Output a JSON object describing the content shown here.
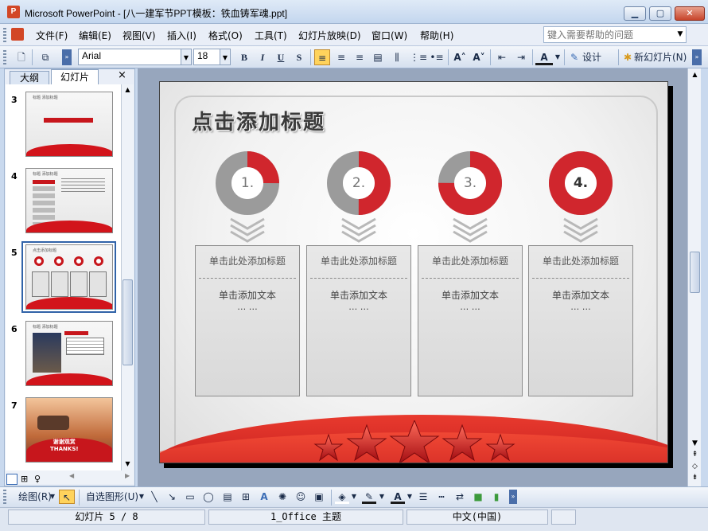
{
  "window": {
    "title": "Microsoft PowerPoint - [八一建军节PPT模板：铁血铸军魂.ppt]",
    "app_icon": "P"
  },
  "menu": {
    "items": [
      "文件(F)",
      "编辑(E)",
      "视图(V)",
      "插入(I)",
      "格式(O)",
      "工具(T)",
      "幻灯片放映(D)",
      "窗口(W)",
      "帮助(H)"
    ],
    "help_placeholder": "键入需要帮助的问题"
  },
  "toolbar": {
    "font": "Arial",
    "size": "18",
    "bold": "B",
    "italic": "I",
    "underline": "U",
    "shadow": "S",
    "design": "设计(S)",
    "new_slide": "新幻灯片(N)"
  },
  "left_pane": {
    "tabs": [
      "大纲",
      "幻灯片"
    ],
    "close": "×",
    "slide_numbers": [
      "3",
      "4",
      "5",
      "6",
      "7"
    ],
    "thumb7_text": "谢谢观赏\nTHANKS!"
  },
  "slide": {
    "title": "点击添加标题",
    "steps": [
      {
        "label": "1.",
        "fill": 0.25,
        "heading": "单击此处添加标题",
        "text": "单击添加文本",
        "dots": "… …"
      },
      {
        "label": "2.",
        "fill": 0.5,
        "heading": "单击此处添加标题",
        "text": "单击添加文本",
        "dots": "… …"
      },
      {
        "label": "3.",
        "fill": 0.75,
        "heading": "单击此处添加标题",
        "text": "单击添加文本",
        "dots": "… …"
      },
      {
        "label": "4.",
        "fill": 1.0,
        "heading": "单击此处添加标题",
        "text": "单击添加文本",
        "dots": "… …"
      }
    ],
    "colors": {
      "accent": "#d0262d",
      "grey": "#9b9b9b"
    }
  },
  "drawbar": {
    "draw": "绘图(R)",
    "autoshapes": "自选图形(U)"
  },
  "status": {
    "slide": "幻灯片 5 / 8",
    "theme": "1_Office 主题",
    "language": "中文(中国)"
  }
}
